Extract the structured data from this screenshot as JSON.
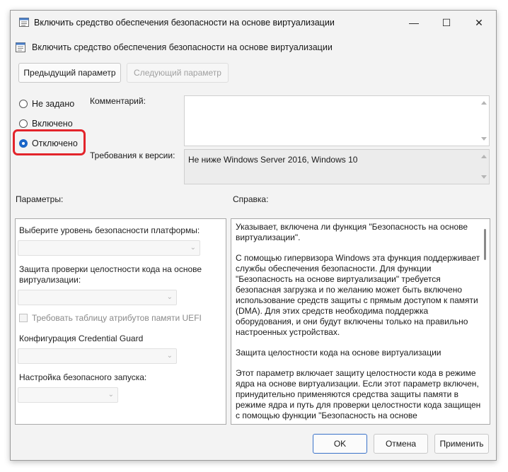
{
  "window": {
    "title": "Включить средство обеспечения безопасности на основе виртуализации",
    "minimize": "—",
    "maximize": "☐",
    "close": "✕"
  },
  "header": {
    "policy_name": "Включить средство обеспечения безопасности на основе виртуализации",
    "prev_button": "Предыдущий параметр",
    "next_button": "Следующий параметр"
  },
  "state": {
    "options": [
      {
        "label": "Не задано",
        "selected": false
      },
      {
        "label": "Включено",
        "selected": false
      },
      {
        "label": "Отключено",
        "selected": true
      }
    ],
    "highlight_color": "#e3242b",
    "accent_color": "#1a66c8"
  },
  "comment": {
    "label": "Комментарий:",
    "value": ""
  },
  "version": {
    "label": "Требования к версии:",
    "value": "Не ниже Windows Server 2016, Windows 10"
  },
  "parameters": {
    "label": "Параметры:",
    "platform_security_label": "Выберите уровень безопасности платформы:",
    "platform_security_value": "",
    "code_integrity_label_line1": "Защита проверки целостности кода на основе",
    "code_integrity_label_line2": "виртуализации:",
    "code_integrity_value": "",
    "uefi_checkbox_label": "Требовать таблицу атрибутов памяти UEFI",
    "credential_guard_label": "Конфигурация Credential Guard",
    "credential_guard_value": "",
    "secure_launch_label": "Настройка безопасного запуска:",
    "secure_launch_value": ""
  },
  "help": {
    "label": "Справка:",
    "paragraphs": [
      "Указывает, включена ли функция \"Безопасность на основе виртуализации\".",
      "С помощью гипервизора Windows эта функция поддерживает службы обеспечения безопасности. Для функции \"Безопасность на основе виртуализации\" требуется безопасная загрузка и по желанию может быть включено использование средств защиты с прямым доступом к памяти (DMA). Для этих средств необходима поддержка оборудования, и они будут включены только на правильно настроенных устройствах.",
      "Защита целостности кода на основе виртуализации",
      "Этот параметр включает защиту целостности кода в режиме ядра на основе виртуализации. Если этот параметр включен, принудительно применяются средства защиты памяти в режиме ядра и путь для проверки целостности кода защищен с помощью функции \"Безопасность на основе"
    ]
  },
  "footer": {
    "ok": "OK",
    "cancel": "Отмена",
    "apply": "Применить"
  }
}
